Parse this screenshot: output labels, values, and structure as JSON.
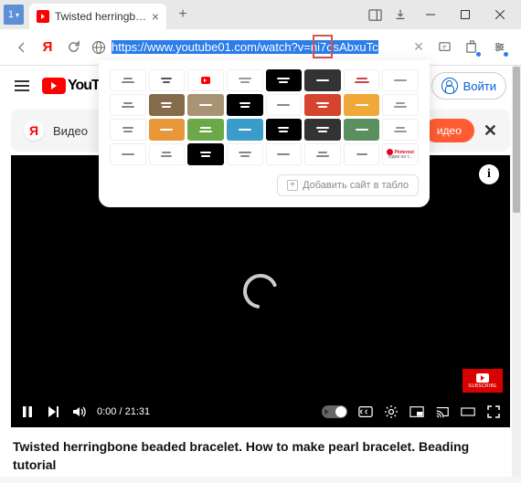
{
  "titlebar": {
    "tab_count": "1",
    "tab_title": "Twisted herringbone be",
    "new_tab": "+"
  },
  "addressbar": {
    "url_full": "https://www.youtube01.com/watch?v=ni7osAbxuTc",
    "url_clear": "×"
  },
  "youtube": {
    "logo_text": "YouTube",
    "login_label": "Войти"
  },
  "notice": {
    "icon_letter": "Я",
    "text": "Видео",
    "button": "идео",
    "close": "✕"
  },
  "video": {
    "info": "i",
    "subscribe": "SUBSCRIBE",
    "time": "0:00 / 21:31",
    "title": "Twisted herringbone beaded bracelet. How to make pearl bracelet. Beading tutorial"
  },
  "dropdown": {
    "add_site": "Добавить сайт в табло",
    "pinterest": "Pinterest",
    "ideas": "Идеи на т...",
    "tiles": [
      [
        {
          "bg": "#fff",
          "lines": [
            "#888",
            "#888"
          ],
          "w": [
            10,
            14
          ]
        },
        {
          "bg": "#fff",
          "lines": [
            "#555",
            "#555"
          ],
          "w": [
            12,
            8
          ]
        },
        {
          "bg": "#fff",
          "dot": "#ff0000"
        },
        {
          "bg": "#fff",
          "lines": [
            "#999",
            "#999"
          ],
          "w": [
            14,
            10
          ]
        },
        {
          "bg": "#000",
          "lines": [
            "#fff",
            "#fff"
          ],
          "w": [
            14,
            10
          ]
        },
        {
          "bg": "#333",
          "lines": [
            "#fff"
          ],
          "w": [
            14
          ]
        },
        {
          "bg": "#fff",
          "lines": [
            "#c44",
            "#c44"
          ],
          "w": [
            12,
            16
          ]
        },
        {
          "bg": "#fff",
          "lines": [
            "#999"
          ],
          "w": [
            14
          ]
        }
      ],
      [
        {
          "bg": "#fff",
          "lines": [
            "#888",
            "#888"
          ],
          "w": [
            10,
            14
          ]
        },
        {
          "bg": "#856b4a",
          "lines": [
            "#fff",
            "#fff"
          ],
          "w": [
            12,
            10
          ]
        },
        {
          "bg": "#a89474",
          "lines": [
            "#fff"
          ],
          "w": [
            14
          ]
        },
        {
          "bg": "#000",
          "lines": [
            "#fff",
            "#fff"
          ],
          "w": [
            12,
            10
          ]
        },
        {
          "bg": "#fff",
          "lines": [
            "#888"
          ],
          "w": [
            14
          ]
        },
        {
          "bg": "#d4442e",
          "lines": [
            "#fff",
            "#fff"
          ],
          "w": [
            14,
            10
          ]
        },
        {
          "bg": "#f0a838",
          "lines": [
            "#fff"
          ],
          "w": [
            14
          ]
        },
        {
          "bg": "#fff",
          "lines": [
            "#999",
            "#999"
          ],
          "w": [
            10,
            14
          ]
        }
      ],
      [
        {
          "bg": "#fff",
          "lines": [
            "#888",
            "#888"
          ],
          "w": [
            12,
            10
          ]
        },
        {
          "bg": "#e89838",
          "lines": [
            "#fff"
          ],
          "w": [
            14
          ]
        },
        {
          "bg": "#6ba848",
          "lines": [
            "#fff",
            "#fff"
          ],
          "w": [
            12,
            14
          ]
        },
        {
          "bg": "#3a9cc8",
          "lines": [
            "#fff"
          ],
          "w": [
            14
          ]
        },
        {
          "bg": "#000",
          "lines": [
            "#fff",
            "#fff"
          ],
          "w": [
            12,
            10
          ]
        },
        {
          "bg": "#333",
          "lines": [
            "#fff",
            "#fff"
          ],
          "w": [
            14,
            10
          ]
        },
        {
          "bg": "#5a9060",
          "lines": [
            "#fff"
          ],
          "w": [
            14
          ]
        },
        {
          "bg": "#fff",
          "lines": [
            "#999",
            "#999"
          ],
          "w": [
            10,
            14
          ]
        }
      ],
      [
        {
          "bg": "#fff",
          "lines": [
            "#888"
          ],
          "w": [
            14
          ]
        },
        {
          "bg": "#fff",
          "lines": [
            "#888",
            "#888"
          ],
          "w": [
            10,
            12
          ]
        },
        {
          "bg": "#000",
          "lines": [
            "#fff",
            "#fff"
          ],
          "w": [
            12,
            10
          ]
        },
        {
          "bg": "#fff",
          "lines": [
            "#888",
            "#888"
          ],
          "w": [
            14,
            10
          ]
        },
        {
          "bg": "#fff",
          "lines": [
            "#888"
          ],
          "w": [
            14
          ]
        },
        {
          "bg": "#fff",
          "lines": [
            "#888",
            "#888"
          ],
          "w": [
            10,
            14
          ]
        },
        {
          "bg": "#fff",
          "lines": [
            "#888"
          ],
          "w": [
            12
          ]
        },
        {
          "bg": "#fff",
          "pinterest": true
        }
      ]
    ]
  }
}
